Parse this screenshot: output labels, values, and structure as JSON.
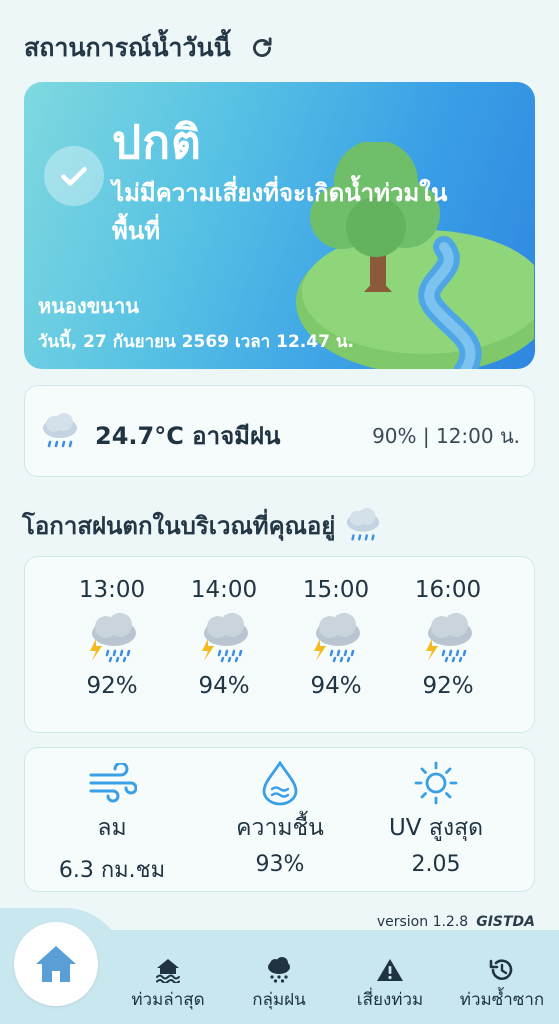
{
  "header": {
    "title": "สถานการณ์น้ำวันนี้",
    "refresh_icon": "refresh-icon"
  },
  "status": {
    "title": "ปกติ",
    "description": "ไม่มีความเสี่ยงที่จะเกิดน้ำท่วมในพื้นที่",
    "location": "หนองขนาน",
    "datetime": "วันนี้, 27 กันยายน 2569 เวลา 12.47 น.",
    "icon": "check-circle-icon"
  },
  "weather": {
    "icon": "rain-cloud-icon",
    "summary": "24.7°C อาจมีฝน",
    "chance_time": "90% | 12:00 น."
  },
  "forecast_section": {
    "title": "โอกาสฝนตกในบริเวณที่คุณอยู่",
    "icon": "rain-cloud-icon"
  },
  "forecast": [
    {
      "time": "13:00",
      "percent": "92%",
      "icon": "thunderstorm-icon"
    },
    {
      "time": "14:00",
      "percent": "94%",
      "icon": "thunderstorm-icon"
    },
    {
      "time": "15:00",
      "percent": "94%",
      "icon": "thunderstorm-icon"
    },
    {
      "time": "16:00",
      "percent": "92%",
      "icon": "thunderstorm-icon"
    }
  ],
  "stats": [
    {
      "label": "ลม",
      "value": "6.3 กม.ชม",
      "icon": "wind-icon"
    },
    {
      "label": "ความชื้น",
      "value": "93%",
      "icon": "humidity-icon"
    },
    {
      "label": "UV สูงสุด",
      "value": "2.05",
      "icon": "sun-icon"
    }
  ],
  "footer": {
    "version": "version 1.2.8",
    "logo": "GISTDA"
  },
  "nav": {
    "home_icon": "home-icon",
    "items": [
      {
        "label": "ท่วมล่าสุด",
        "icon": "flood-icon"
      },
      {
        "label": "กลุ่มฝน",
        "icon": "rain-cloud-icon"
      },
      {
        "label": "เสี่ยงท่วม",
        "icon": "warning-icon"
      },
      {
        "label": "ท่วมซ้ำซาก",
        "icon": "history-icon"
      }
    ]
  },
  "colors": {
    "card_gradient_start": "#7fd9df",
    "card_gradient_end": "#2f86e0",
    "nav_bg": "#c9e7ee",
    "page_bg": "#eef7f8"
  }
}
